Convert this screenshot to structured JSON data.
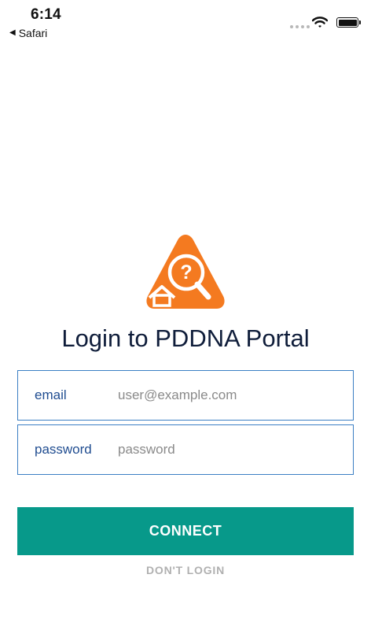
{
  "status_bar": {
    "time": "6:14",
    "back_app": "Safari",
    "icons": [
      "signal-dots-icon",
      "wifi-icon",
      "battery-icon"
    ]
  },
  "logo": {
    "icon": "house-magnifier-question-logo",
    "colors": {
      "orange": "#f47a20",
      "white": "#ffffff"
    }
  },
  "title": "Login to PDDNA Portal",
  "form": {
    "email": {
      "label": "email",
      "placeholder": "user@example.com",
      "value": ""
    },
    "password": {
      "label": "password",
      "placeholder": "password",
      "value": ""
    }
  },
  "buttons": {
    "connect": "CONNECT",
    "dont_login": "DON'T LOGIN"
  },
  "colors": {
    "accent": "#07998a",
    "field_border": "#3b7fc4",
    "label": "#1f4c90",
    "title": "#0f1d3a",
    "secondary_button_text": "#b0b0b0"
  }
}
